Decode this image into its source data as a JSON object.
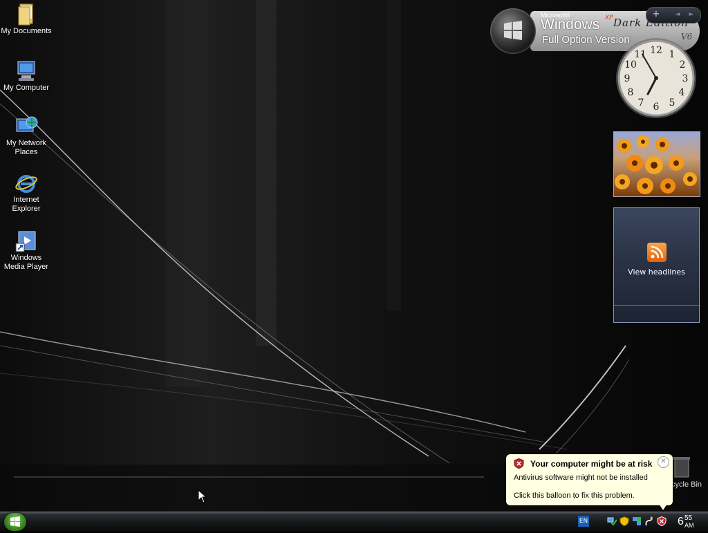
{
  "desktop": {
    "icons": [
      {
        "label": "My Documents",
        "icon": "folder-documents-icon"
      },
      {
        "label": "My Computer",
        "icon": "computer-icon"
      },
      {
        "label": "My Network Places",
        "icon": "network-places-icon"
      },
      {
        "label": "Internet Explorer",
        "icon": "internet-explorer-icon"
      },
      {
        "label": "Windows Media Player",
        "icon": "media-player-icon"
      }
    ],
    "recycle_bin_label": "Recycle Bin"
  },
  "branding": {
    "microsoft": "Microsoft®",
    "windows": "Windows",
    "xp": "XP",
    "dark_edition": "Dark Edition",
    "full_option": "Full Option Version",
    "version": "V6"
  },
  "sidebar": {
    "controls": {
      "add": "+",
      "prev": "◄",
      "next": "►"
    },
    "clock": {
      "hour": 6,
      "minute": 55
    },
    "feed": {
      "label": "View headlines"
    }
  },
  "balloon": {
    "title": "Your computer might be at risk",
    "line1": "Antivirus software might not be installed",
    "line2": "Click this balloon to fix this problem.",
    "close": "✕"
  },
  "taskbar": {
    "language": "EN",
    "time_hour": "6",
    "time_minute": "55",
    "time_ampm": "AM"
  },
  "colors": {
    "balloon_bg": "#ffffe1",
    "taskbar": "#151719",
    "start_green": "#3c8b22"
  }
}
